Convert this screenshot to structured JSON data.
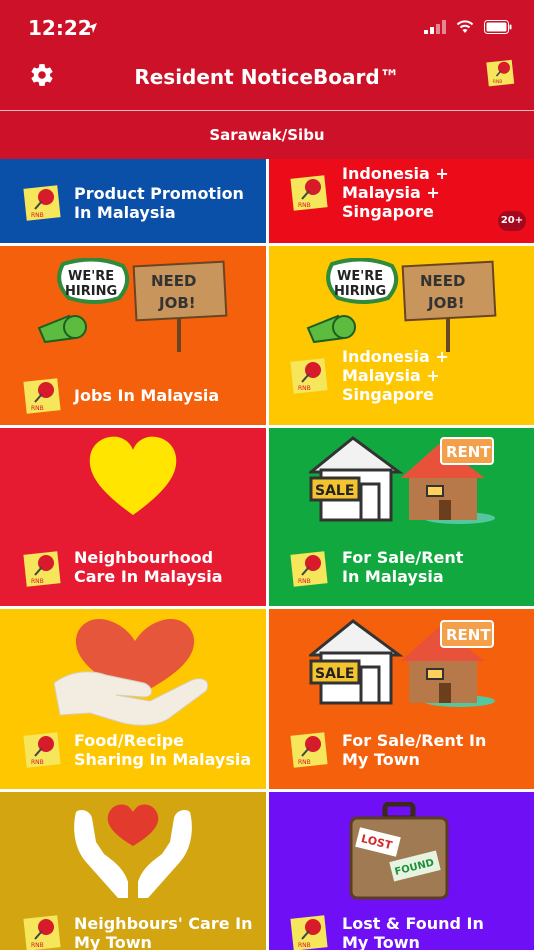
{
  "status": {
    "time": "12:22"
  },
  "header": {
    "title": "Resident NoticeBoard™",
    "location": "Sarawak/Sibu"
  },
  "colors": {
    "header": "#cc1128",
    "blue": "#0a4fa8",
    "red": "#ec0b18",
    "orange": "#f5600c",
    "yellow": "#ffc700",
    "crimson": "#e61b32",
    "green": "#11a93f",
    "gold": "#d2a511",
    "purple": "#6e0ff5"
  },
  "tiles": [
    {
      "title": "Product Promotion\nIn Malaysia",
      "icon": "pushpin-sticky-note-icon"
    },
    {
      "title": "Indonesia +\nMalaysia +\nSingapore",
      "badge": "20+",
      "icon": "pushpin-sticky-note-icon"
    },
    {
      "title": "Jobs In Malaysia",
      "icon": "pushpin-sticky-note-icon",
      "sign1": "WE'RE\nHIRING",
      "sign2": "NEED\nJOB!"
    },
    {
      "title": "Indonesia +\nMalaysia +\nSingapore",
      "icon": "pushpin-sticky-note-icon",
      "sign1": "WE'RE\nHIRING",
      "sign2": "NEED\nJOB!"
    },
    {
      "title": "Neighbourhood\nCare In Malaysia",
      "icon": "pushpin-sticky-note-icon"
    },
    {
      "title": "For Sale/Rent\nIn Malaysia",
      "icon": "pushpin-sticky-note-icon",
      "sale": "SALE",
      "rent": "RENT"
    },
    {
      "title": "Food/Recipe\nSharing In Malaysia",
      "icon": "pushpin-sticky-note-icon"
    },
    {
      "title": "For Sale/Rent In\nMy Town",
      "icon": "pushpin-sticky-note-icon",
      "sale": "SALE",
      "rent": "RENT"
    },
    {
      "title": "Neighbours' Care In\nMy Town",
      "icon": "pushpin-sticky-note-icon"
    },
    {
      "title": "Lost & Found In\nMy Town",
      "icon": "pushpin-sticky-note-icon",
      "lost": "LOST",
      "found": "FOUND"
    }
  ]
}
